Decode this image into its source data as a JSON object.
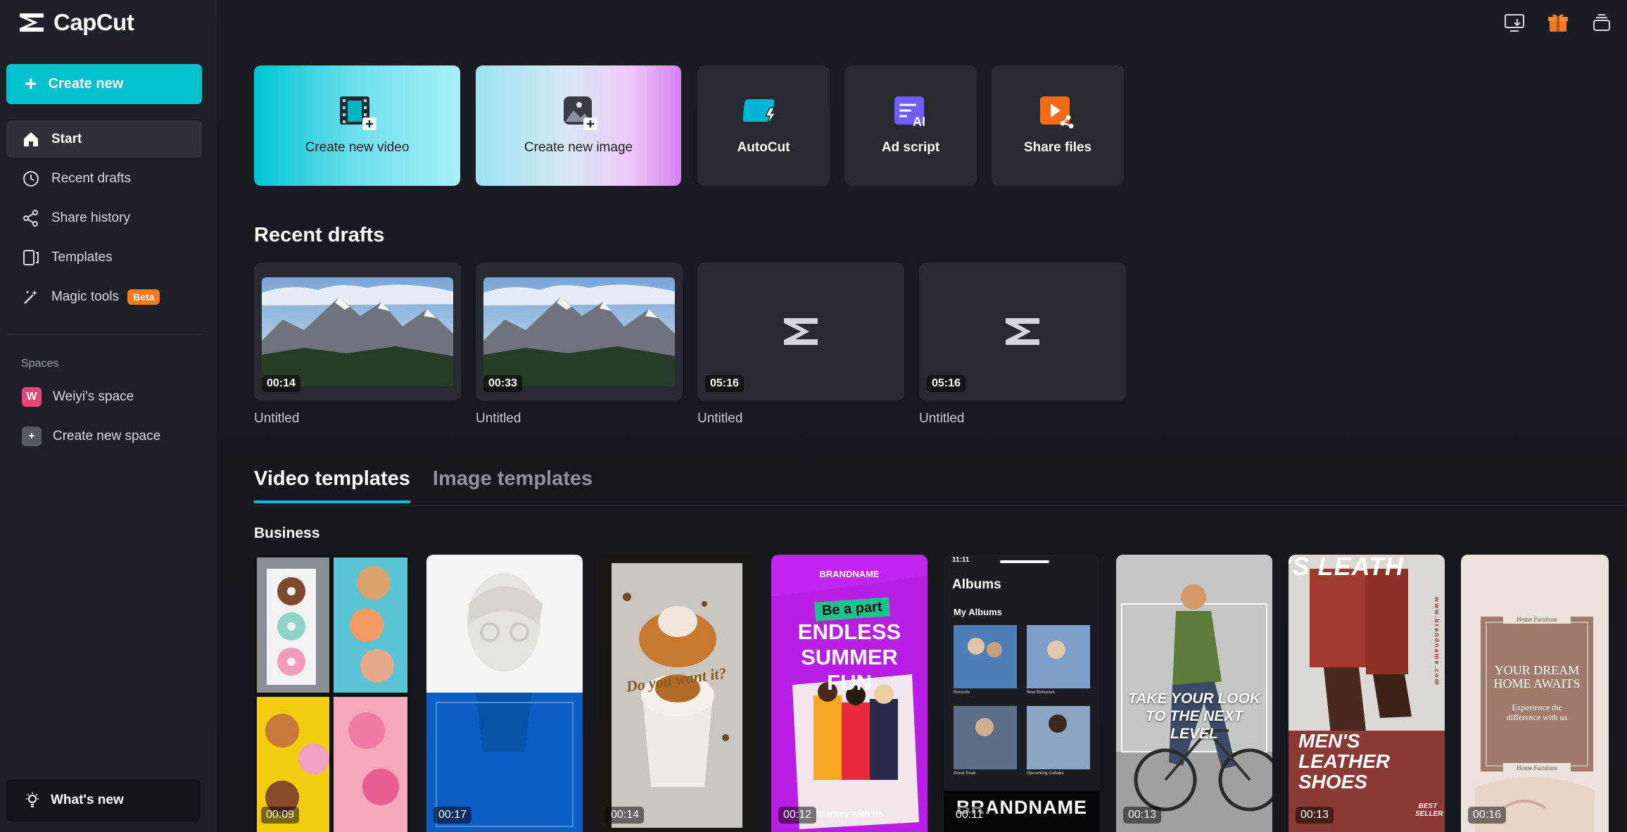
{
  "app": {
    "name": "CapCut"
  },
  "sidebar": {
    "create_label": "Create new",
    "items": [
      {
        "label": "Start"
      },
      {
        "label": "Recent drafts"
      },
      {
        "label": "Share history"
      },
      {
        "label": "Templates"
      },
      {
        "label": "Magic tools",
        "badge": "Beta"
      }
    ],
    "spaces_label": "Spaces",
    "spaces": [
      {
        "initial": "W",
        "label": "Weiyi's space",
        "color": "#e8457a"
      },
      {
        "initial": "+",
        "label": "Create new space",
        "color": "#555962"
      }
    ],
    "whats_new": "What's new"
  },
  "quick_actions": [
    {
      "label": "Create new video"
    },
    {
      "label": "Create new image"
    },
    {
      "label": "AutoCut"
    },
    {
      "label": "Ad script"
    },
    {
      "label": "Share files"
    }
  ],
  "recent_drafts": {
    "title": "Recent drafts",
    "items": [
      {
        "duration": "00:14",
        "title": "Untitled",
        "thumb": "mountain"
      },
      {
        "duration": "00:33",
        "title": "Untitled",
        "thumb": "mountain"
      },
      {
        "duration": "05:16",
        "title": "Untitled",
        "thumb": "placeholder"
      },
      {
        "duration": "05:16",
        "title": "Untitled",
        "thumb": "placeholder"
      }
    ]
  },
  "templates": {
    "tabs": [
      {
        "label": "Video templates"
      },
      {
        "label": "Image templates"
      }
    ],
    "category": "Business",
    "items": [
      {
        "duration": "00:09"
      },
      {
        "duration": "00:17"
      },
      {
        "duration": "00:14",
        "text": "Do you want it?"
      },
      {
        "duration": "00:12",
        "brand": "BRANDNAME",
        "tag": "Be a part",
        "headline": "ENDLESS SUMMER FUN",
        "footer": "Journey with us."
      },
      {
        "duration": "00:11",
        "time": "11:11",
        "title": "Albums",
        "subtitle": "My Albums",
        "brand": "BRANDNAME",
        "albums": [
          "Recents",
          "New Releases",
          "Great Peak",
          "Upcoming Collabs"
        ]
      },
      {
        "duration": "00:13",
        "headline": "TAKE YOUR LOOK TO THE NEXT LEVEL"
      },
      {
        "duration": "00:13",
        "top": "'S LEATH",
        "headline": "MEN'S LEATHER SHOES",
        "badge": "BEST SELLER",
        "side": "www.brandname.com"
      },
      {
        "duration": "00:16",
        "label_top": "Home Furniture",
        "headline": "YOUR DREAM HOME AWAITS",
        "sub": "Experience the difference with us",
        "label_bottom": "Home Furniture"
      }
    ]
  },
  "colors": {
    "accent": "#00c1cd",
    "beta": "#f47a1f",
    "gift": "#f07a22"
  },
  "icons": [
    "capcut-logo-icon",
    "download-icon",
    "gift-icon",
    "layers-icon"
  ]
}
